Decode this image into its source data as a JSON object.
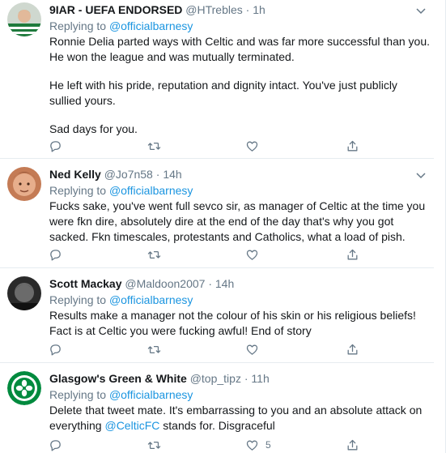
{
  "tweets": [
    {
      "name": "9IAR - UEFA ENDORSED",
      "handle": "@HTrebles",
      "sep": "·",
      "time": "1h",
      "reply_prefix": "Replying to",
      "reply_to": "@officialbarnesy",
      "paragraphs": [
        "Ronnie Delia parted ways with Celtic and was far more successful than you. He won the league and was mutually terminated.",
        "He left with his pride, reputation and dignity intact. You've just publicly sullied yours.",
        "Sad days for you."
      ],
      "like_count": ""
    },
    {
      "name": "Ned Kelly",
      "handle": "@Jo7n58",
      "sep": "·",
      "time": "14h",
      "reply_prefix": "Replying to",
      "reply_to": "@officialbarnesy",
      "paragraphs": [
        "Fucks sake, you've went full sevco sir, as manager of Celtic at the time you were  fkn dire, absolutely dire at the end of the day that's why you got sacked. Fkn timescales, protestants and Catholics, what a load of pish."
      ],
      "like_count": ""
    },
    {
      "name": "Scott Mackay",
      "handle": "@Maldoon2007",
      "sep": "·",
      "time": "14h",
      "reply_prefix": "Replying to",
      "reply_to": "@officialbarnesy",
      "paragraphs": [
        "Results make a manager not the colour of his skin or his religious beliefs! Fact is at Celtic you were fucking awful! End of story"
      ],
      "like_count": ""
    },
    {
      "name": "Glasgow's Green & White",
      "handle": "@top_tipz",
      "sep": "·",
      "time": "11h",
      "reply_prefix": "Replying to",
      "reply_to": "@officialbarnesy",
      "body_pre": "Delete that tweet mate. It's embarrassing to you and an absolute attack on everything ",
      "body_mention": "@CelticFC",
      "body_post": " stands for. Disgraceful",
      "like_count": "5"
    }
  ],
  "icons": [
    "reply-icon",
    "retweet-icon",
    "like-icon",
    "share-icon",
    "chevron-down-icon"
  ],
  "colors": {
    "text": "#14171a",
    "secondary": "#657786",
    "link": "#1b95e0",
    "border": "#e6ecf0",
    "celtic_green": "#008a3e"
  }
}
